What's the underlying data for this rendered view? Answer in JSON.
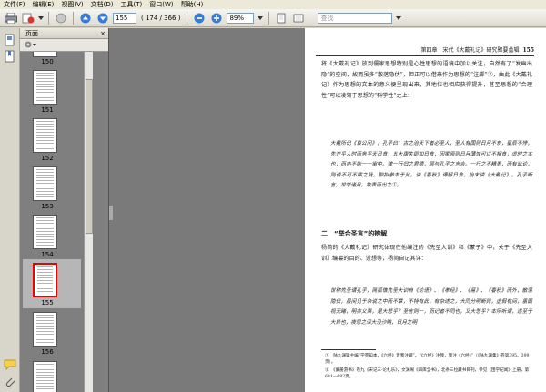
{
  "menu": [
    "文件(F)",
    "编辑(E)",
    "视图(V)",
    "文档(D)",
    "工具(T)",
    "窗口(W)",
    "帮助(H)"
  ],
  "toolbar": {
    "page_input": "155",
    "page_count": "( 174 / 366 )",
    "zoom": "89%",
    "search_placeholder": "查找"
  },
  "nav_panel": {
    "title": "页面",
    "close": "×"
  },
  "thumbnails": [
    "150",
    "151",
    "152",
    "153",
    "154",
    "155",
    "156"
  ],
  "selected_page": "155",
  "page": {
    "running_head": "第四章　宋代《大戴礼记》研究聚要蠡辑",
    "page_number": "155",
    "para1": "将《大戴礼记》放到儒家思想特别是心性思想的语境中加以关注，自然有了“发幽出隐”的空间，故而虽多“散落隐伏”，但正可以借来作为思想的“注脚”②，由此《大戴礼记》作为思想的文本的意义便呈现出来，其地位也相应获得提升，甚至思想的“合理性”可以凌驾于思想的“科学性”之上：",
    "quote1": "大戴所记《哀公问》，孔子曰：古之治天下者必圣人，圣人有国则日月不食，星辰不悖，先齐乎人时而务乎天日食，五大康失即如日食，因家原则日月薄蚀可以不相食，虚时之本也，而亦不能一一审中。律一行归之君德，顾与孔子之言合。一行之不精表，而有此论，则诚不可不察之哉，聊拟参书于此。读《春秋》谭解日食，始末读《大戴记》。孔子断言，世举诸月，故表而出之①。",
    "section_title": "二　“举合圣言”的辨解",
    "para2": "杨简的《大戴礼记》研究体现在他编注的《先圣大训》和《蒙子》中，关于《先圣大训》编纂的目的、设想等，杨简自记其详：",
    "quote2": "世称先圣谓孔子，简狐惟先圣大训自《论语》、《孝经》、《易》、《春秋》而外，散落隐伏，虽间见于杂说之中而不章，不特有此，有杂述之，大同分明断异，虚假有间，虽面视无睹，明亦义乘，是大悲乎？圣言则一，而记者不同也，又大悲乎？本所听谓，遂至于大异也，夜思之深大没沙略，日月之明",
    "footnotes": [
      "①　陆九渊辑主编“学苑知本，《六经》皆我注脚”。“《六经》注我，我注《六经》”（《陆九渊集》卷第395、399页）。",
      "②　《蒙册游书》卷九《宋记三·论札乐》，文渊阁《四库全书》，北条三拉藏书目刊，参见《困学纪闻》上册，第681—682页。"
    ]
  }
}
